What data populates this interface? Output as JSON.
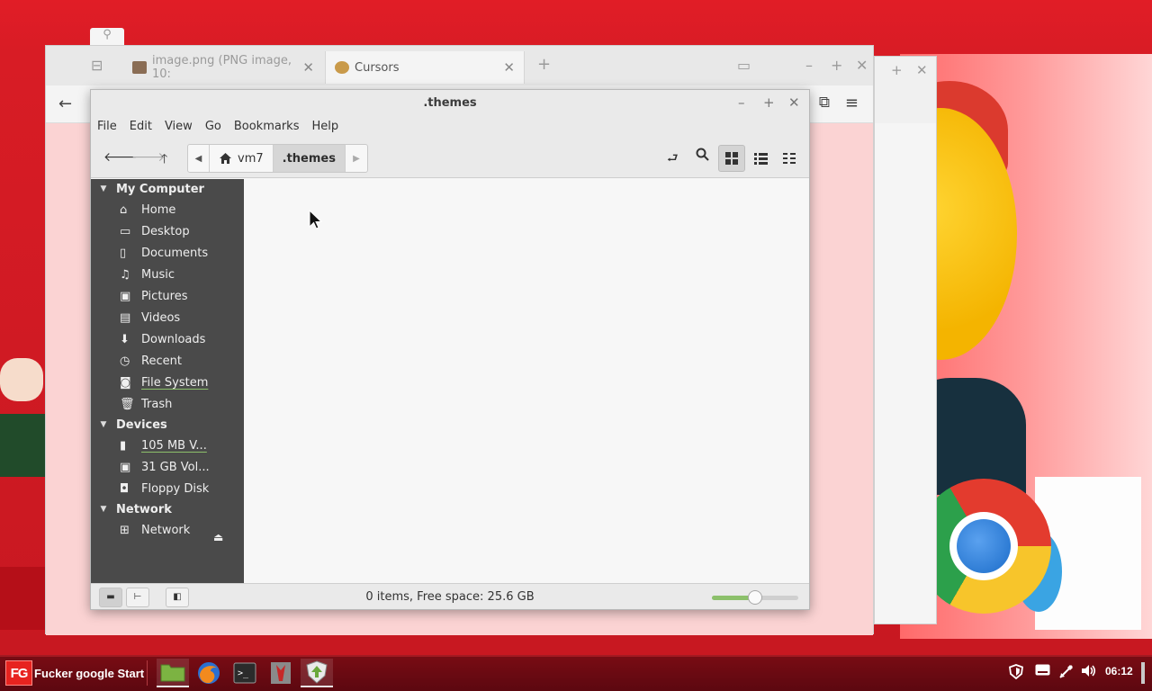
{
  "browser": {
    "tab1_title": "image.png (PNG image, 10:",
    "tab2_title": "Cursors"
  },
  "file_manager": {
    "window_title": ".themes",
    "menu": [
      "File",
      "Edit",
      "View",
      "Go",
      "Bookmarks",
      "Help"
    ],
    "path": {
      "home_segment": "vm7",
      "current_segment": ".themes"
    },
    "sidebar": {
      "my_computer": {
        "header": "My Computer",
        "items": [
          "Home",
          "Desktop",
          "Documents",
          "Music",
          "Pictures",
          "Videos",
          "Downloads",
          "Recent",
          "File System",
          "Trash"
        ]
      },
      "devices": {
        "header": "Devices",
        "items": [
          "105 MB V...",
          "31 GB Vol...",
          "Floppy Disk"
        ]
      },
      "network": {
        "header": "Network",
        "items": [
          "Network"
        ]
      }
    },
    "status_text": "0 items, Free space: 25.6 GB",
    "zoom_level": 0.5
  },
  "taskbar": {
    "start_logo_text": "FG",
    "start_label": "Fucker google Start",
    "clock": "06:12"
  },
  "colors": {
    "desktop_red": "#d81c25",
    "sidebar_bg": "#4a4a4a",
    "accent_green": "#8cc06b",
    "taskbar_bg": "#6b0a12"
  }
}
